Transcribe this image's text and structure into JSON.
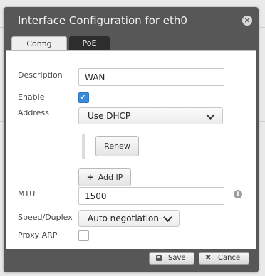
{
  "dialog": {
    "title": "Interface Configuration for eth0",
    "close_glyph": "×"
  },
  "tabs": [
    {
      "label": "Config",
      "active": true
    },
    {
      "label": "PoE",
      "active": false
    }
  ],
  "form": {
    "description": {
      "label": "Description",
      "value": "WAN"
    },
    "enable": {
      "label": "Enable",
      "checked": true,
      "check_glyph": "✓"
    },
    "address": {
      "label": "Address",
      "selected": "Use DHCP"
    },
    "renew_button": "Renew",
    "add_ip": {
      "icon_glyph": "+",
      "label": "Add IP"
    },
    "mtu": {
      "label": "MTU",
      "value": "1500",
      "info_glyph": "i"
    },
    "speed_duplex": {
      "label": "Speed/Duplex",
      "selected": "Auto negotiation"
    },
    "proxy_arp": {
      "label": "Proxy ARP",
      "checked": false
    }
  },
  "footer": {
    "save_label": "Save",
    "cancel_label": "Cancel",
    "cancel_glyph": "✖"
  },
  "colors": {
    "dialog_bg": "#575757",
    "checkbox_accent": "#3b8bd8",
    "inactive_tab": "#2d2d2d"
  },
  "icons": [
    "close-icon",
    "check-icon",
    "chevron-down-icon",
    "plus-icon",
    "info-icon",
    "save-icon",
    "cancel-icon"
  ]
}
